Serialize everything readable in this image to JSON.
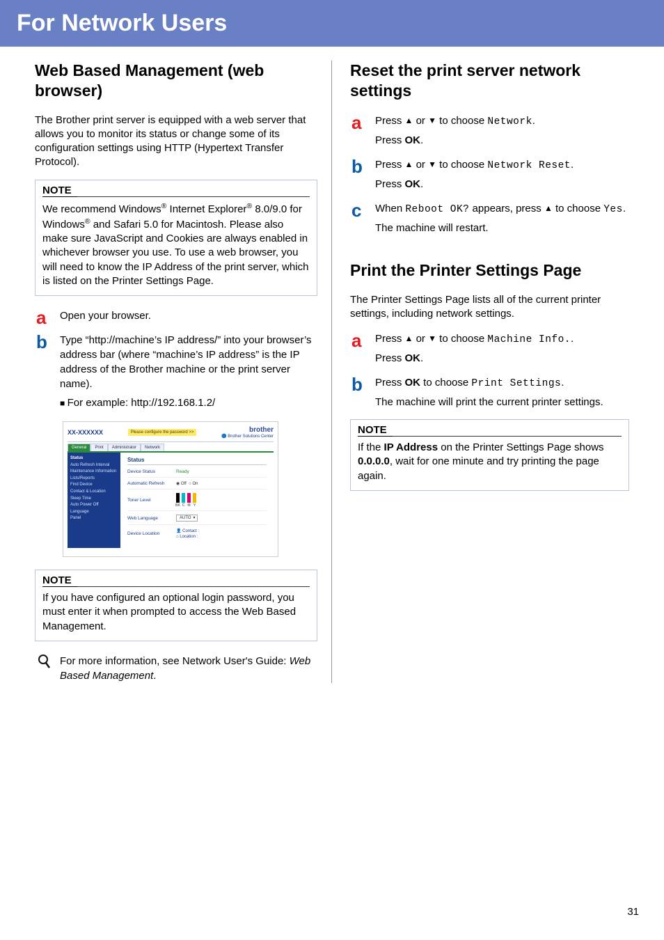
{
  "banner": "For Network Users",
  "page_number": "31",
  "left": {
    "title": "Web Based Management (web browser)",
    "intro": "The Brother print server is equipped with a web server that allows you to monitor its status or change some of its configuration settings using HTTP (Hypertext Transfer Protocol).",
    "note1_title": "NOTE",
    "note1_body_parts": [
      "We recommend Windows",
      " Internet Explorer",
      " 8.0/9.0 for Windows",
      " and Safari 5.0 for Macintosh. Please also make sure JavaScript and Cookies are always enabled in whichever browser you use. To use a web browser, you will need to know the IP Address of the print server, which is listed on the Printer Settings Page."
    ],
    "step_a": "Open your browser.",
    "step_b": "Type “http://machine’s IP address/” into your browser’s address bar (where “machine’s IP address” is the IP address of the Brother machine or the print server name).",
    "step_b_example": "For example: http://192.168.1.2/",
    "note2_title": "NOTE",
    "note2_body": "If you have configured an optional login password, you must enter it when prompted to access the Web Based Management.",
    "info_prefix": "For more information, see Network User's Guide: ",
    "info_em": "Web Based Management",
    "info_suffix": "."
  },
  "screenshot": {
    "model": "XX-XXXXXX",
    "please": "Please configure the password >>",
    "brand": "brother",
    "subbrand": "Brother Solutions Center",
    "tabs": [
      "General",
      "Print",
      "Administrator",
      "Network"
    ],
    "side": [
      "Status",
      "Auto Refresh Interval",
      "Maintenance Information",
      "Lists/Reports",
      "Find Device",
      "Contact & Location",
      "Sleep Time",
      "Auto Power Off",
      "Language",
      "Panel"
    ],
    "main_title": "Status",
    "rows": {
      "device_status": {
        "label": "Device Status",
        "value": "Ready"
      },
      "auto_refresh": {
        "label": "Automatic Refresh",
        "off": "Off",
        "on": "On"
      },
      "toner_level": {
        "label": "Toner Level",
        "labels": [
          "BK",
          "C",
          "M",
          "Y"
        ]
      },
      "web_language": {
        "label": "Web Language",
        "value": "AUTO"
      },
      "device_location": {
        "label": "Device Location",
        "contact": "Contact :",
        "location": "Location :"
      }
    }
  },
  "right": {
    "title1": "Reset the print server network settings",
    "r1a_p1_pre": "Press ",
    "r1a_p1_mid": " or ",
    "r1a_p1_post": " to choose ",
    "r1a_p1_mono": "Network",
    "r1a_p1_end": ".",
    "r1a_p2_pre": "Press ",
    "r1a_p2_b": "OK",
    "r1a_p2_end": ".",
    "r1b_p1_pre": "Press ",
    "r1b_p1_mid": " or ",
    "r1b_p1_post": " to choose ",
    "r1b_p1_mono": "Network Reset",
    "r1b_p1_end": ".",
    "r1b_p2_pre": "Press ",
    "r1b_p2_b": "OK",
    "r1b_p2_end": ".",
    "r1c_p1_pre": "When ",
    "r1c_p1_mono": "Reboot OK?",
    "r1c_p1_mid": " appears, press ",
    "r1c_p1_post": " to choose ",
    "r1c_p1_mono2": "Yes",
    "r1c_p1_end": ".",
    "r1c_p2": "The machine will restart.",
    "title2": "Print the Printer Settings Page",
    "intro2": "The Printer Settings Page lists all of the current printer settings, including network settings.",
    "r2a_p1_pre": "Press ",
    "r2a_p1_mid": " or ",
    "r2a_p1_post": " to choose ",
    "r2a_p1_mono": "Machine Info.",
    "r2a_p1_end": ".",
    "r2a_p2_pre": "Press ",
    "r2a_p2_b": "OK",
    "r2a_p2_end": ".",
    "r2b_p1_pre": "Press ",
    "r2b_p1_b": "OK",
    "r2b_p1_mid": " to choose ",
    "r2b_p1_mono": "Print Settings",
    "r2b_p1_end": ".",
    "r2b_p2": "The machine will print the current printer settings.",
    "note_title": "NOTE",
    "note_body_pre": "If the ",
    "note_body_b1": "IP Address",
    "note_body_mid": " on the Printer Settings Page shows ",
    "note_body_b2": "0.0.0.0",
    "note_body_post": ", wait for one minute and try printing the page again."
  }
}
